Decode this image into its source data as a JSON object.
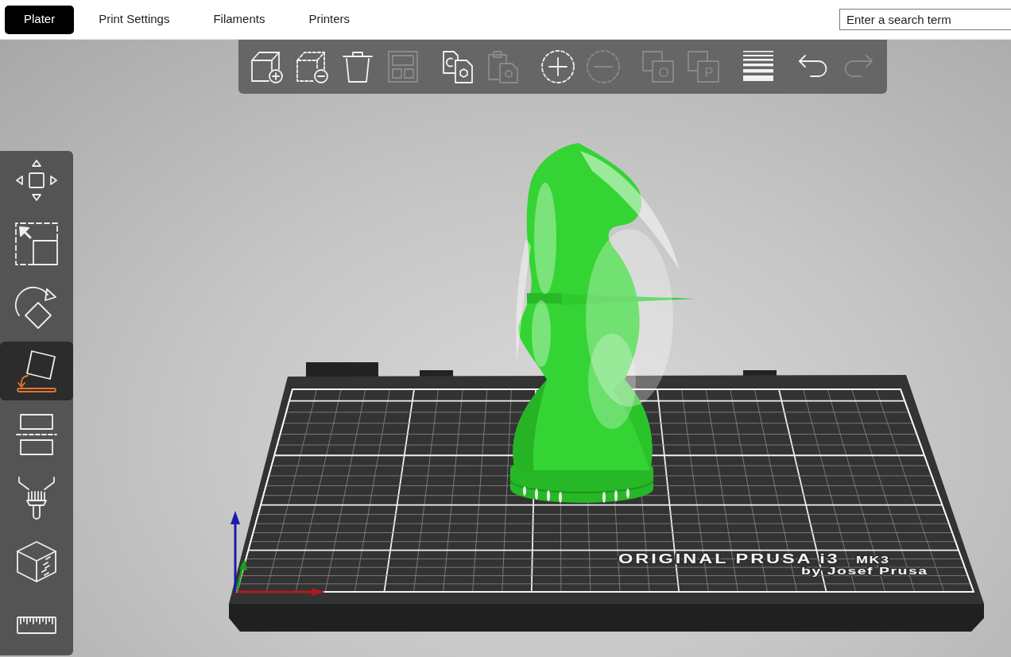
{
  "tabs": [
    {
      "label": "Plater",
      "selected": true
    },
    {
      "label": "Print Settings",
      "selected": false
    },
    {
      "label": "Filaments",
      "selected": false
    },
    {
      "label": "Printers",
      "selected": false
    }
  ],
  "search": {
    "placeholder": "Enter a search term"
  },
  "top_toolbar": {
    "groups": [
      {
        "buttons": [
          {
            "kind": "add",
            "disabled": false
          },
          {
            "kind": "delete",
            "disabled": false
          },
          {
            "kind": "delete_all",
            "disabled": false
          },
          {
            "kind": "arrange",
            "disabled": true
          }
        ]
      },
      {
        "buttons": [
          {
            "kind": "copy",
            "disabled": false
          },
          {
            "kind": "paste",
            "disabled": true
          }
        ]
      },
      {
        "buttons": [
          {
            "kind": "add_instance",
            "disabled": false
          },
          {
            "kind": "remove_instance",
            "disabled": true
          }
        ]
      },
      {
        "buttons": [
          {
            "kind": "split_objects",
            "disabled": true,
            "glyph": "O"
          },
          {
            "kind": "split_parts",
            "disabled": true,
            "glyph": "P"
          }
        ]
      },
      {
        "buttons": [
          {
            "kind": "layers",
            "disabled": false
          }
        ]
      },
      {
        "buttons": [
          {
            "kind": "undo",
            "disabled": false
          },
          {
            "kind": "redo",
            "disabled": true
          }
        ]
      }
    ]
  },
  "gizmo_toolbar": [
    {
      "kind": "move",
      "selected": false
    },
    {
      "kind": "scale",
      "selected": false
    },
    {
      "kind": "rotate",
      "selected": false
    },
    {
      "kind": "place",
      "selected": true
    },
    {
      "kind": "cut",
      "selected": false
    },
    {
      "kind": "paint",
      "selected": false
    },
    {
      "kind": "seam",
      "selected": false
    },
    {
      "kind": "measure",
      "selected": false
    }
  ],
  "bed_label": {
    "title": "ORIGINAL PRUSA i3",
    "model": "MK3",
    "byline": "by Josef Prusa"
  }
}
